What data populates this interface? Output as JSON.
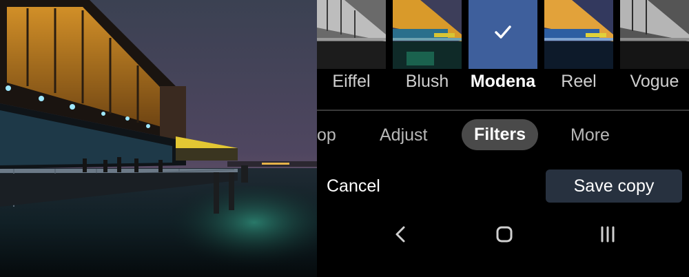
{
  "filters": {
    "items": [
      {
        "label": "Eiffel",
        "selected": false
      },
      {
        "label": "Blush",
        "selected": false
      },
      {
        "label": "Modena",
        "selected": true
      },
      {
        "label": "Reel",
        "selected": false
      },
      {
        "label": "Vogue",
        "selected": false
      }
    ]
  },
  "tabs": {
    "items": [
      {
        "label": "op",
        "active": false
      },
      {
        "label": "Adjust",
        "active": false
      },
      {
        "label": "Filters",
        "active": true
      },
      {
        "label": "More",
        "active": false
      }
    ]
  },
  "actions": {
    "cancel_label": "Cancel",
    "save_label": "Save copy"
  },
  "nav": {
    "back_icon": "back-chevron-icon",
    "home_icon": "home-icon",
    "recents_icon": "recents-icon"
  },
  "colors": {
    "selected_filter": "#3e5f9c",
    "save_button": "#27313f",
    "active_tab": "#4a4a4a"
  }
}
